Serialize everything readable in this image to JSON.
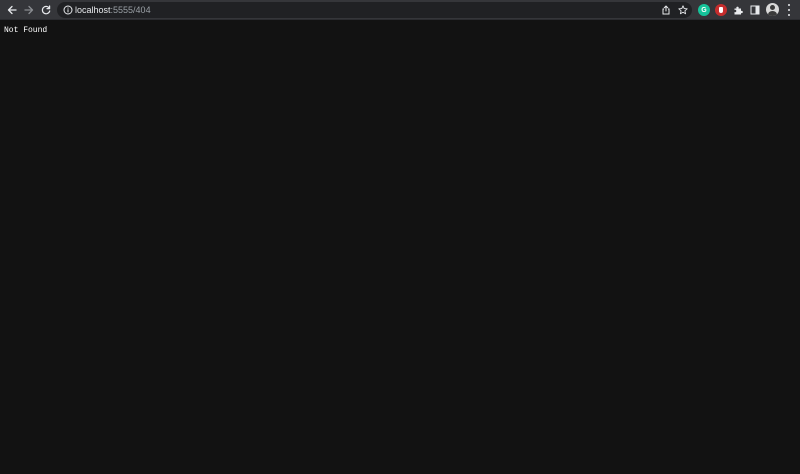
{
  "toolbar": {
    "back_icon": "arrow-left-icon",
    "forward_icon": "arrow-right-icon",
    "reload_icon": "reload-icon"
  },
  "address_bar": {
    "host": "localhost",
    "path": ":5555/404",
    "info_icon": "info-icon",
    "share_icon": "share-icon",
    "bookmark_icon": "star-icon"
  },
  "extensions": {
    "items": [
      {
        "name": "grammarly-icon",
        "color": "#15c39a"
      },
      {
        "name": "shield-extension-icon",
        "color": "#c62d2d"
      }
    ],
    "puzzle_icon": "puzzle-icon",
    "side_panel_icon": "side-panel-icon",
    "profile_icon": "avatar-icon",
    "menu_icon": "kebab-menu-icon"
  },
  "page": {
    "message": "Not Found",
    "background": "#121212",
    "text_color": "#ffffff"
  }
}
